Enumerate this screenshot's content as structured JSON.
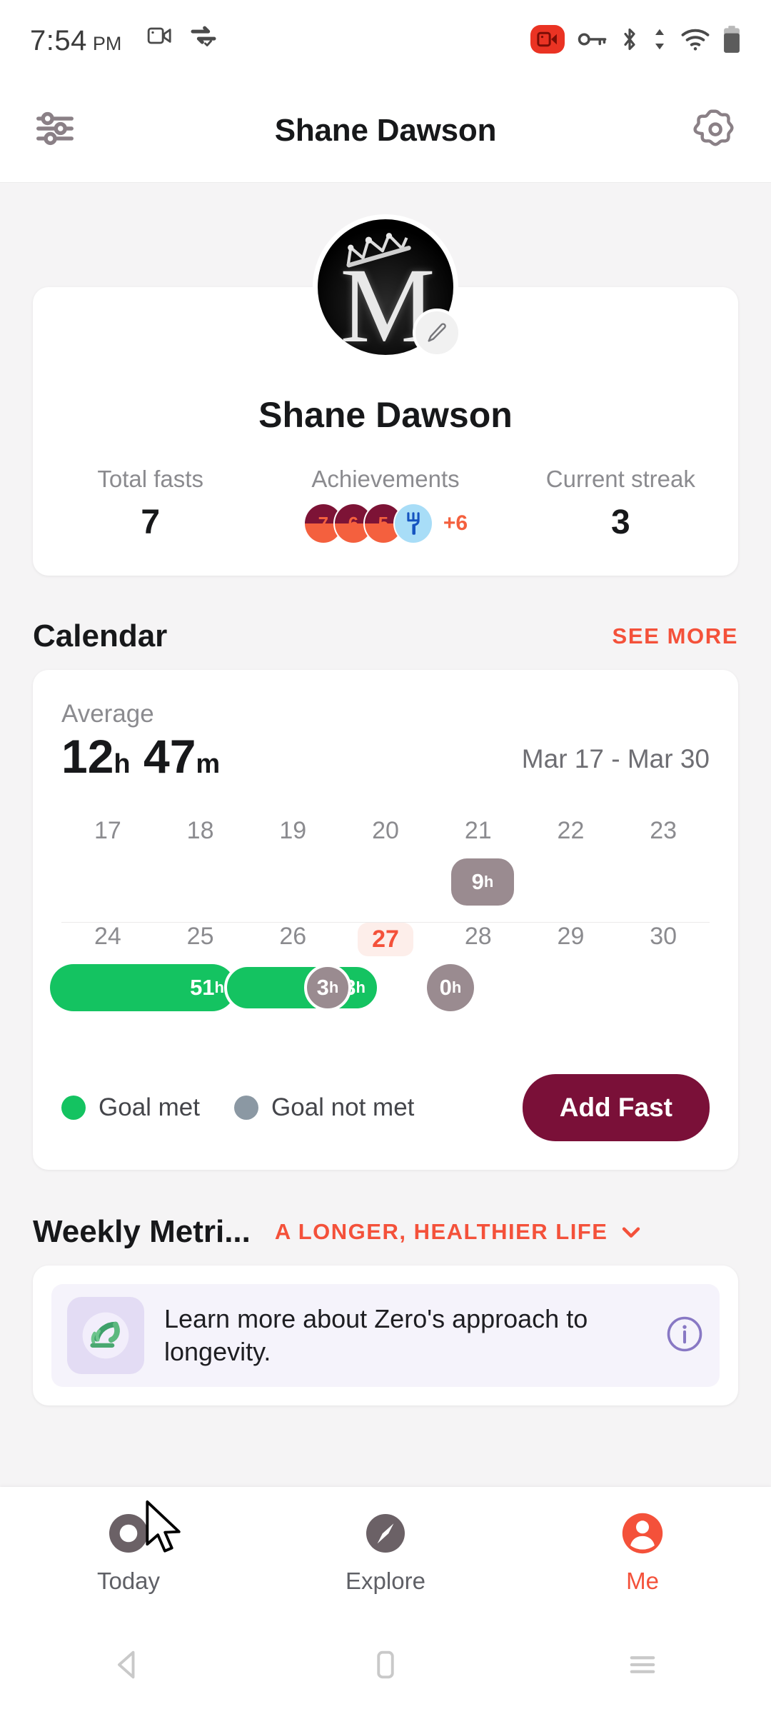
{
  "status_bar": {
    "time": "7:54",
    "ampm": "PM",
    "icons": [
      "video-call-icon",
      "vpn-sync-icon",
      "screen-record-icon",
      "vpn-key-icon",
      "bluetooth-icon",
      "data-transfer-icon",
      "wifi-icon",
      "battery-icon"
    ]
  },
  "header": {
    "title": "Shane Dawson",
    "left_icon": "sliders-icon",
    "right_icon": "gear-icon"
  },
  "profile": {
    "name": "Shane Dawson",
    "avatar_letter": "M",
    "edit_icon": "pencil-icon",
    "stats": [
      {
        "label": "Total fasts",
        "value": "7"
      },
      {
        "label": "Achievements",
        "value": ""
      },
      {
        "label": "Current streak",
        "value": "3"
      }
    ],
    "achievements": {
      "badges": [
        "7",
        "6",
        "5"
      ],
      "fork_badge_icon": "fork-icon",
      "more_label": "+6"
    }
  },
  "calendar": {
    "section_title": "Calendar",
    "see_more_label": "SEE MORE",
    "average_label": "Average",
    "average_hours": "12",
    "average_hours_unit": "h",
    "average_minutes": "47",
    "average_minutes_unit": "m",
    "date_range": "Mar 17 - Mar 30",
    "legend": [
      {
        "label": "Goal met",
        "color": "#14c361"
      },
      {
        "label": "Goal not met",
        "color": "#8b98a3"
      }
    ],
    "add_fast_label": "Add Fast",
    "today": "27",
    "rows": [
      {
        "days": [
          "17",
          "18",
          "19",
          "20",
          "21",
          "22",
          "23"
        ],
        "entries": [
          {
            "day": "21",
            "value": "9",
            "unit": "h",
            "type": "pill-wide",
            "goal_met": false
          }
        ]
      },
      {
        "days": [
          "24",
          "25",
          "26",
          "27",
          "28",
          "29",
          "30"
        ],
        "entries": [
          {
            "day": "24",
            "value": "51",
            "unit": "h",
            "type": "bar",
            "goal_met": true
          },
          {
            "day": "25",
            "value": "23",
            "unit": "h",
            "type": "bar",
            "goal_met": true
          },
          {
            "day": "26",
            "value": "3",
            "unit": "h",
            "type": "dot",
            "goal_met": false
          },
          {
            "day": "27",
            "value": "0",
            "unit": "h",
            "type": "dot",
            "goal_met": false
          }
        ]
      }
    ]
  },
  "weekly_metrics": {
    "title": "Weekly Metri...",
    "pill_label": "A LONGER, HEALTHIER LIFE",
    "chevron_icon": "chevron-down-icon",
    "banner": {
      "icon": "leaf-sprout-icon",
      "text": "Learn more about Zero's approach to longevity.",
      "info_icon": "info-icon"
    }
  },
  "bottom_nav": {
    "items": [
      {
        "label": "Today",
        "icon": "ring-icon",
        "active": false
      },
      {
        "label": "Explore",
        "icon": "compass-icon",
        "active": false
      },
      {
        "label": "Me",
        "icon": "person-icon",
        "active": true
      }
    ],
    "active_color": "#f4513a"
  },
  "android_nav": {
    "back_icon": "back-triangle-icon",
    "home_icon": "home-square-icon",
    "recents_icon": "recents-lines-icon"
  }
}
